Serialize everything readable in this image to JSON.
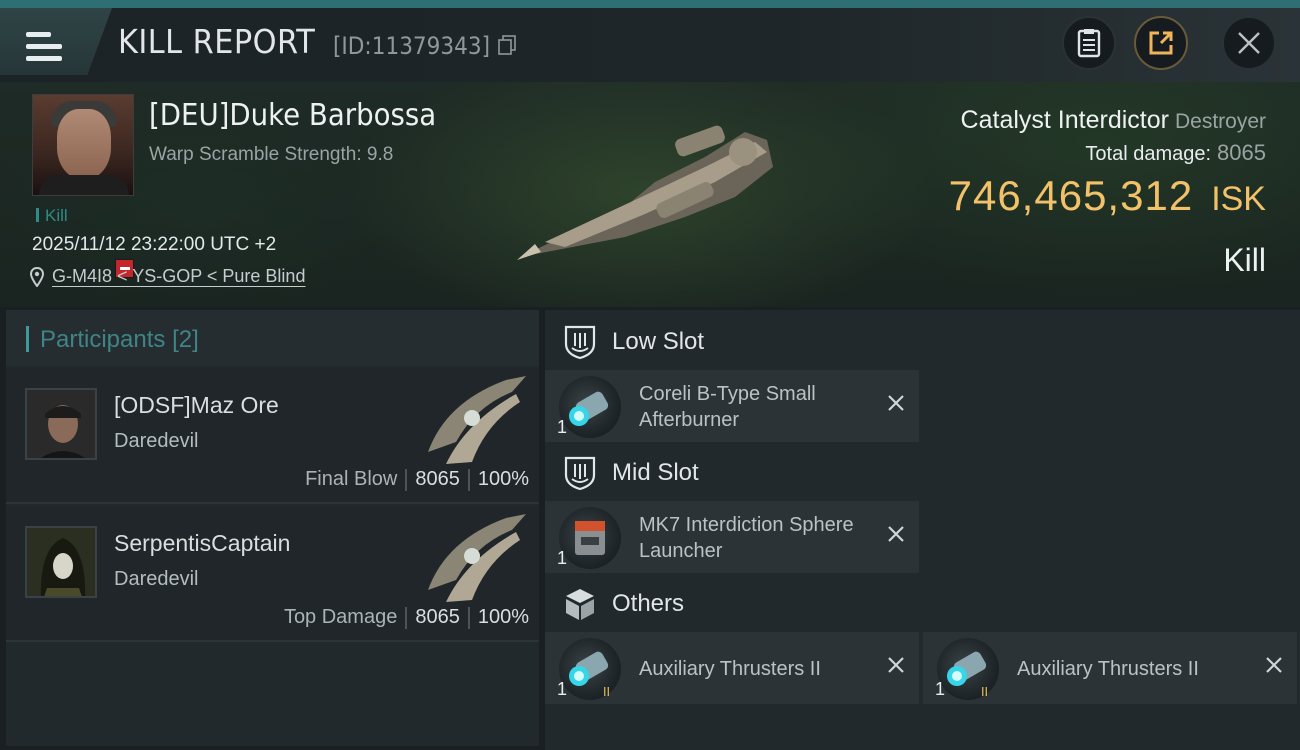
{
  "header": {
    "title": "KILL REPORT",
    "report_id": "[ID:11379343]"
  },
  "victim": {
    "name": "[DEU]Duke Barbossa",
    "subtitle": "Warp Scramble Strength: 9.8",
    "tag": "Kill",
    "datetime": "2025/11/12 23:22:00 UTC +2",
    "location": "G-M4I8 < YS-GOP < Pure Blind",
    "ship_name": "Catalyst Interdictor",
    "ship_class": "Destroyer",
    "total_damage_label": "Total damage:",
    "total_damage": "8065",
    "isk_value": "746,465,312",
    "isk_unit": "ISK",
    "outcome": "Kill"
  },
  "participants": {
    "label": "Participants",
    "count": "[2]",
    "rows": [
      {
        "name": "[ODSF]Maz Ore",
        "ship": "Daredevil",
        "role": "Final Blow",
        "damage": "8065",
        "percent": "100%"
      },
      {
        "name": "SerpentisCaptain",
        "ship": "Daredevil",
        "role": "Top Damage",
        "damage": "8065",
        "percent": "100%"
      }
    ]
  },
  "fitting": {
    "low_slot": {
      "label": "Low Slot",
      "modules": [
        {
          "name": "Coreli B-Type Small Afterburner",
          "qty": "1"
        }
      ]
    },
    "mid_slot": {
      "label": "Mid Slot",
      "modules": [
        {
          "name": "MK7 Interdiction Sphere Launcher",
          "qty": "1"
        }
      ]
    },
    "others": {
      "label": "Others",
      "modules": [
        {
          "name": "Auxiliary Thrusters II",
          "qty": "1"
        },
        {
          "name": "Auxiliary Thrusters II",
          "qty": "1"
        }
      ]
    }
  },
  "icons": [
    "menu-icon",
    "copy-icon",
    "notes-icon",
    "share-icon",
    "close-icon",
    "location-pin-icon",
    "shield-slot-icon",
    "cube-icon",
    "remove-x-icon"
  ],
  "colors": {
    "accent": "#2e6f73",
    "isk": "#f2c26a",
    "participants": "#3f8486",
    "badge": "#c3262b"
  }
}
